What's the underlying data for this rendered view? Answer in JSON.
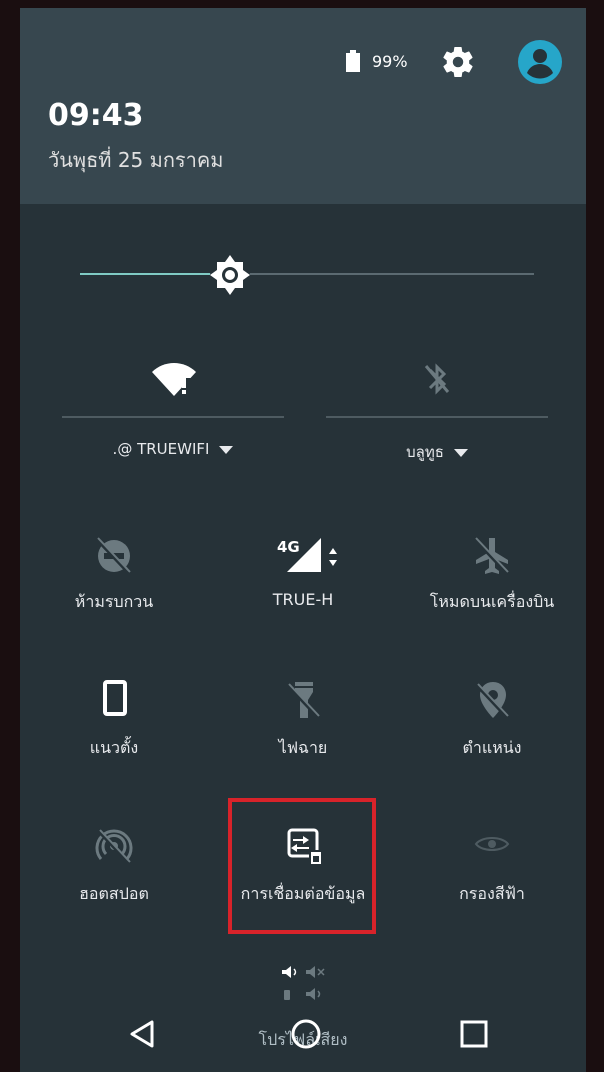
{
  "status": {
    "battery_percent": "99%"
  },
  "header": {
    "time": "09:43",
    "date": "วันพุธที่ 25 มกราคม"
  },
  "brightness": {
    "level": 0.33
  },
  "wifi": {
    "label": ".@ TRUEWIFI"
  },
  "bluetooth": {
    "label": "บลูทูธ"
  },
  "tiles": [
    {
      "label": "ห้ามรบกวน",
      "icon": "do-not-disturb-off-icon"
    },
    {
      "label": "TRUE-H",
      "icon": "signal-4g-icon"
    },
    {
      "label": "โหมดบนเครื่องบิน",
      "icon": "airplane-mode-icon"
    },
    {
      "label": "แนวตั้ง",
      "icon": "portrait-rotation-icon"
    },
    {
      "label": "ไฟฉาย",
      "icon": "flashlight-off-icon"
    },
    {
      "label": "ตำแหน่ง",
      "icon": "location-off-icon"
    },
    {
      "label": "ฮอตสปอต",
      "icon": "hotspot-off-icon"
    },
    {
      "label": "การเชื่อมต่อข้อมูล",
      "icon": "data-connection-icon"
    },
    {
      "label": "กรองสีฟ้า",
      "icon": "blue-light-filter-icon"
    }
  ],
  "sound": {
    "profile_label": "โปรไฟล์เสียง"
  },
  "colors": {
    "accent": "#80cbc4",
    "highlight": "#d8232a",
    "panel": "#263238",
    "header": "#37474f"
  }
}
